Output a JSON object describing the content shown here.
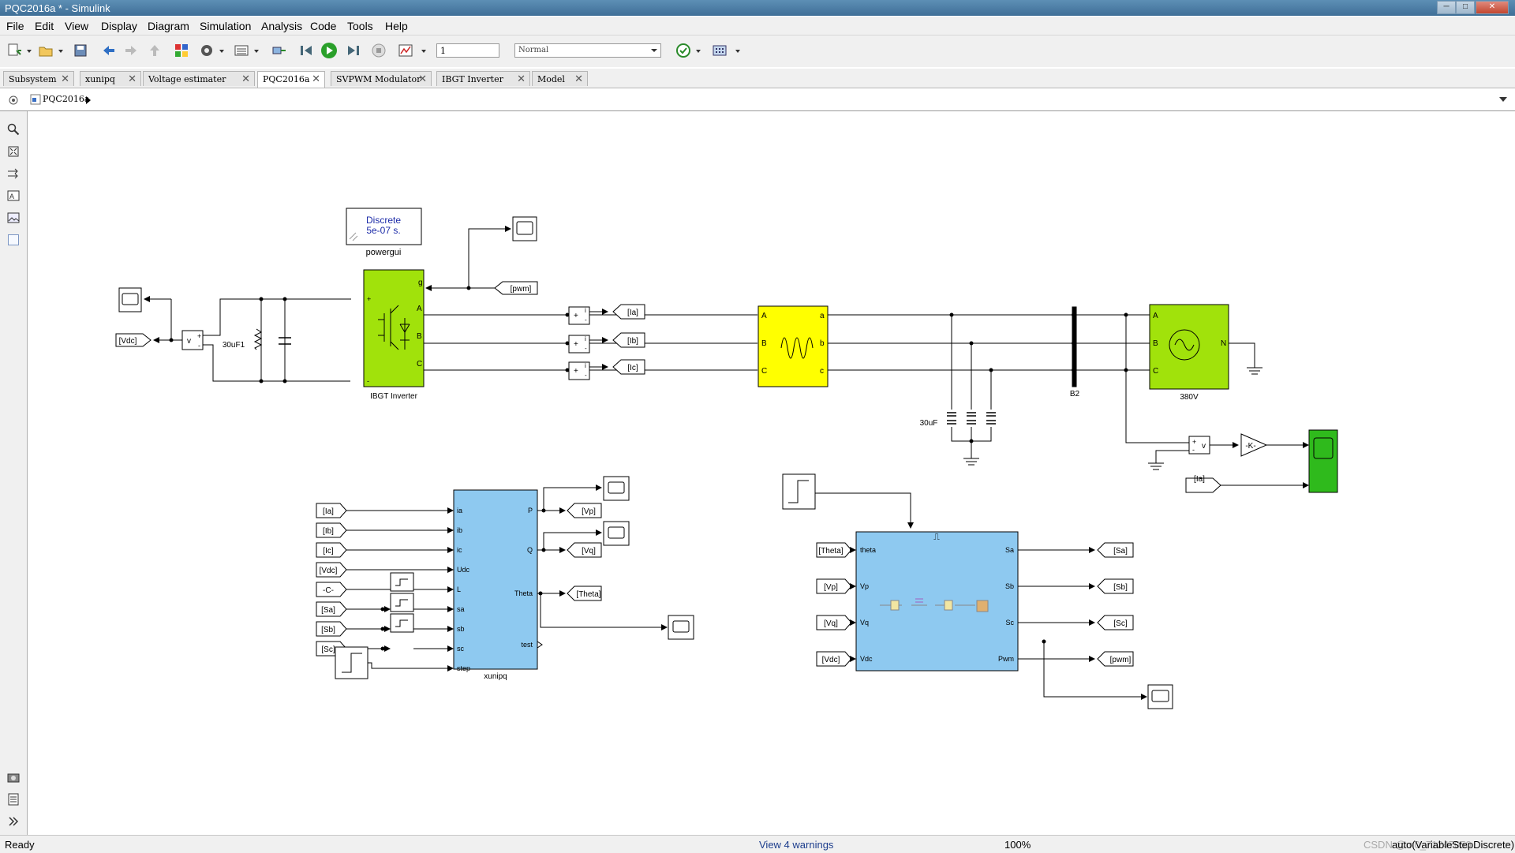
{
  "window": {
    "title": "PQC2016a * - Simulink",
    "min": "─",
    "max": "□",
    "close": "✕"
  },
  "menu": [
    "File",
    "Edit",
    "View",
    "Display",
    "Diagram",
    "Simulation",
    "Analysis",
    "Code",
    "Tools",
    "Help"
  ],
  "toolbar": {
    "stop_time": "1",
    "mode": "Normal"
  },
  "tabs": [
    {
      "label": "Subsystem",
      "close": "✕"
    },
    {
      "label": "xunipq",
      "close": "✕"
    },
    {
      "label": "Voltage estimater",
      "close": "✕"
    },
    {
      "label": "PQC2016a",
      "close": "✕",
      "active": true
    },
    {
      "label": "SVPWM Modulator",
      "close": "✕"
    },
    {
      "label": "IBGT Inverter",
      "close": "✕"
    },
    {
      "label": "Model",
      "close": "✕"
    }
  ],
  "breadcrumb": "PQC2016a",
  "diagram": {
    "powergui_line1": "Discrete",
    "powergui_line2": "5e-07 s.",
    "powergui": "powergui",
    "cap_dc": "30uF1",
    "inverter": "IBGT Inverter",
    "inv_g": "g",
    "inv_a": "A",
    "inv_b": "B",
    "inv_c": "C",
    "inv_plus": "+",
    "inv_minus": "-",
    "tag_pwm": "[pwm]",
    "tag_vdc": "[Vdc]",
    "v": "v",
    "plus": "+",
    "minus": "-",
    "i": "i",
    "tag_ia": "[Ia]",
    "tag_ib": "[Ib]",
    "tag_ic": "[Ic]",
    "ind_A": "A",
    "ind_B": "B",
    "ind_C": "C",
    "ind_a": "a",
    "ind_b": "b",
    "ind_c": "c",
    "cap_ac": "30uF",
    "bus": "B2",
    "src_A": "A",
    "src_B": "B",
    "src_C": "C",
    "src_N": "N",
    "src": "380V",
    "gain": "-K-",
    "xunipq": {
      "name": "xunipq",
      "inputs": [
        "[Ia]",
        "[Ib]",
        "[Ic]",
        "[Vdc]",
        "-C-",
        "[Sa]",
        "[Sb]",
        "[Sc]"
      ],
      "in_ports": [
        "ia",
        "ib",
        "ic",
        "Udc",
        "L",
        "sa",
        "sb",
        "sc",
        "step"
      ],
      "out_ports": [
        "P",
        "Q",
        "Theta",
        "test"
      ],
      "outputs": [
        "[Vp]",
        "[Vq]",
        "[Theta]"
      ]
    },
    "svpwm": {
      "in_tags": [
        "[Theta]",
        "[Vp]",
        "[Vq]",
        "[Vdc]"
      ],
      "in_ports": [
        "theta",
        "Vp",
        "Vq",
        "Vdc"
      ],
      "out_ports": [
        "Sa",
        "Sb",
        "Sc",
        "Pwm"
      ],
      "out_tags": [
        "[Sa]",
        "[Sb]",
        "[Sc]",
        "[pwm]"
      ],
      "trigger": "⎍"
    }
  },
  "status": {
    "left": "Ready",
    "warnings": "View 4 warnings",
    "zoom": "100%",
    "solver": "auto(VariableStepDiscrete)",
    "watermark": "CSDN @m0_71247050"
  }
}
